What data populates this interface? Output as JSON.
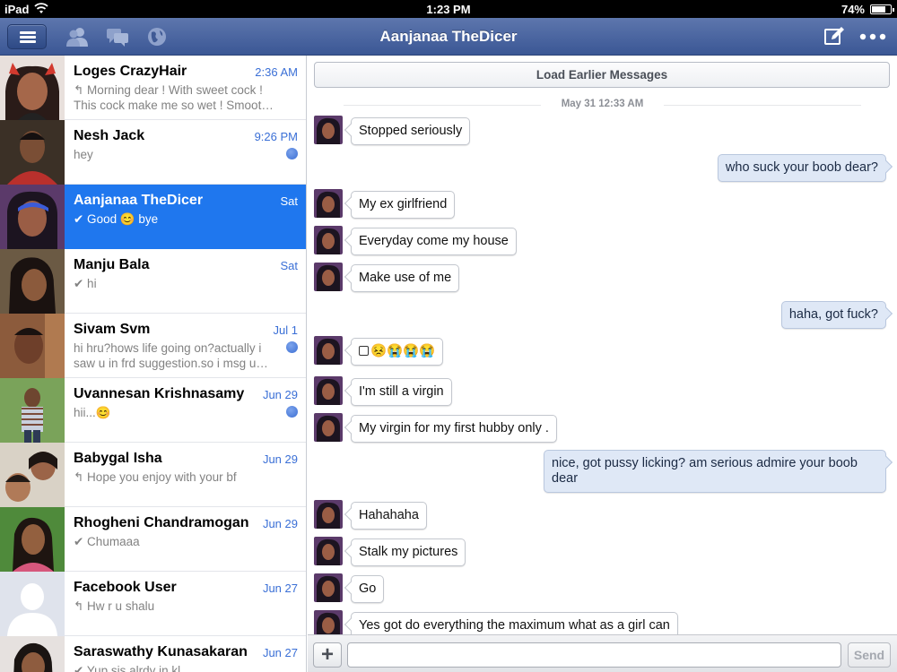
{
  "status_bar": {
    "device": "iPad",
    "time": "1:23 PM",
    "battery_percent": "74%",
    "battery_level": 0.74
  },
  "nav": {
    "title": "Aanjanaa TheDicer",
    "left_icons": [
      "menu-icon",
      "friends-icon",
      "messages-icon",
      "globe-icon"
    ],
    "right_icons": [
      "compose-icon",
      "more-icon"
    ]
  },
  "conversations": [
    {
      "name": "Loges CrazyHair",
      "date": "2:36 AM",
      "preview": "↰ Morning dear ! With sweet cock ! This cock make me so wet ! Smoot…",
      "unread": false,
      "selected": false
    },
    {
      "name": "Nesh Jack",
      "date": "9:26 PM",
      "preview": "hey",
      "unread": true,
      "selected": false
    },
    {
      "name": "Aanjanaa TheDicer",
      "date": "Sat",
      "preview": "✔ Good 😊 bye",
      "unread": false,
      "selected": true
    },
    {
      "name": "Manju Bala",
      "date": "Sat",
      "preview": "✔ hi",
      "unread": false,
      "selected": false
    },
    {
      "name": "Sivam Svm",
      "date": "Jul 1",
      "preview": "hi hru?hows life going on?actually i saw u in frd suggestion.so i msg u…",
      "unread": true,
      "selected": false
    },
    {
      "name": "Uvannesan Krishnasamy",
      "date": "Jun 29",
      "preview": "hii...😊",
      "unread": true,
      "selected": false
    },
    {
      "name": "Babygal Isha",
      "date": "Jun 29",
      "preview": "↰ Hope you enjoy with your bf",
      "unread": false,
      "selected": false
    },
    {
      "name": "Rhogheni Chandramogan",
      "date": "Jun 29",
      "preview": "✔ Chumaaa",
      "unread": false,
      "selected": false
    },
    {
      "name": "Facebook User",
      "date": "Jun 27",
      "preview": "↰ Hw r u shalu",
      "unread": false,
      "selected": false
    },
    {
      "name": "Saraswathy Kunasakaran",
      "date": "Jun 27",
      "preview": "✔ Yup sis alrdy in kl",
      "unread": false,
      "selected": false
    }
  ],
  "chat": {
    "load_earlier": "Load Earlier Messages",
    "date_separator": "May 31 12:33 AM",
    "messages": [
      {
        "dir": "in",
        "text": "Stopped seriously"
      },
      {
        "dir": "out",
        "text": "who suck your boob dear?"
      },
      {
        "dir": "in",
        "text": "My ex girlfriend"
      },
      {
        "dir": "in",
        "text": "Everyday come my house"
      },
      {
        "dir": "in",
        "text": "Make use of me"
      },
      {
        "dir": "out",
        "text": "haha, got fuck?"
      },
      {
        "dir": "in",
        "text": "😣😭😭😭"
      },
      {
        "dir": "in",
        "text": "I'm still a virgin"
      },
      {
        "dir": "in",
        "text": "My virgin for my first hubby only ."
      },
      {
        "dir": "out",
        "text": "nice, got pussy licking? am serious admire your boob dear"
      },
      {
        "dir": "in",
        "text": "Hahahaha"
      },
      {
        "dir": "in",
        "text": "Stalk my pictures"
      },
      {
        "dir": "in",
        "text": "Go"
      },
      {
        "dir": "in",
        "text": "Yes got do everything the maximum what as a girl can"
      }
    ]
  },
  "composer": {
    "placeholder": "",
    "send_label": "Send",
    "plus_label": "+"
  },
  "colors": {
    "navbar": "#3b5795",
    "selected_row": "#1f77ee",
    "date_text": "#3a6fd6",
    "outgoing_bubble": "#dfe8f6"
  }
}
